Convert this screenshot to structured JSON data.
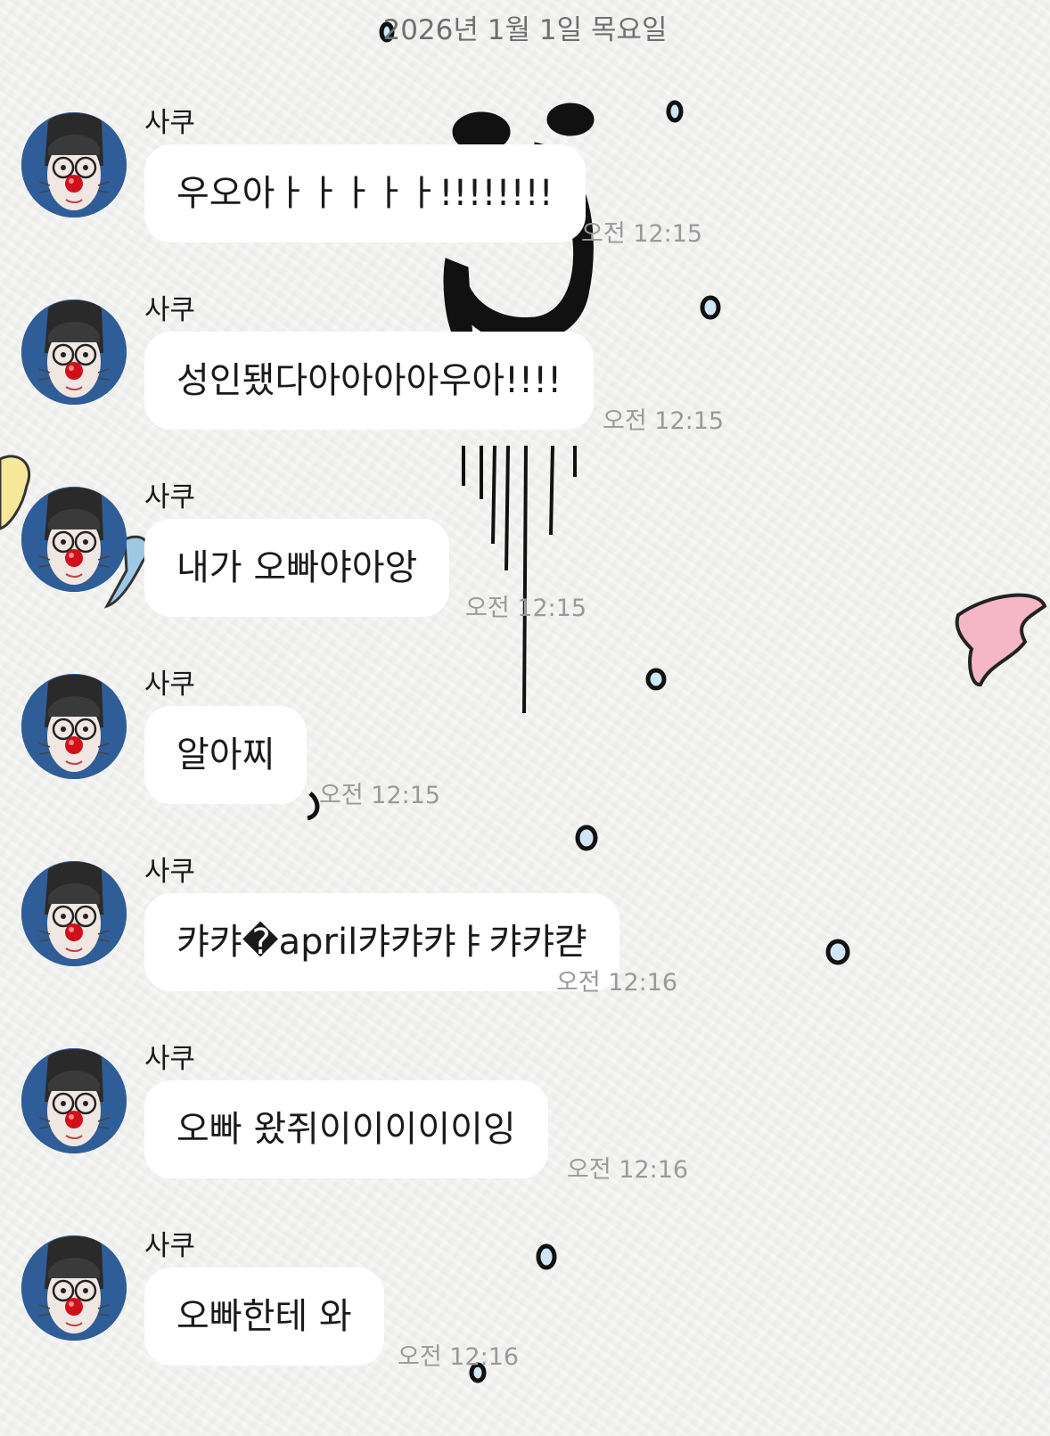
{
  "date_divider": "2026년 1월 1일 목요일",
  "colors": {
    "background": "#f1f1f0",
    "bubble": "#ffffff",
    "time_text": "#9a9a9a",
    "avatar_bg": "#2c5890"
  },
  "messages": [
    {
      "sender": "사쿠",
      "text": "우오아ㅏㅏㅏㅏㅏ!!!!!!!!",
      "time": "오전 12:15"
    },
    {
      "sender": "사쿠",
      "text": "성인됐다아아아아우아!!!!",
      "time": "오전 12:15"
    },
    {
      "sender": "사쿠",
      "text": "내가 오빠야아앙",
      "time": "오전 12:15"
    },
    {
      "sender": "사쿠",
      "text": "알아찌",
      "time": "오전 12:15"
    },
    {
      "sender": "사쿠",
      "text": "캬캬�april캬캬캬ㅑ캬캬캳",
      "time": "오전 12:16"
    },
    {
      "sender": "사쿠",
      "text": "오빠 왔쥐이이이이이잉",
      "time": "오전 12:16"
    },
    {
      "sender": "사쿠",
      "text": "오빠한테 와",
      "time": "오전 12:16"
    }
  ]
}
